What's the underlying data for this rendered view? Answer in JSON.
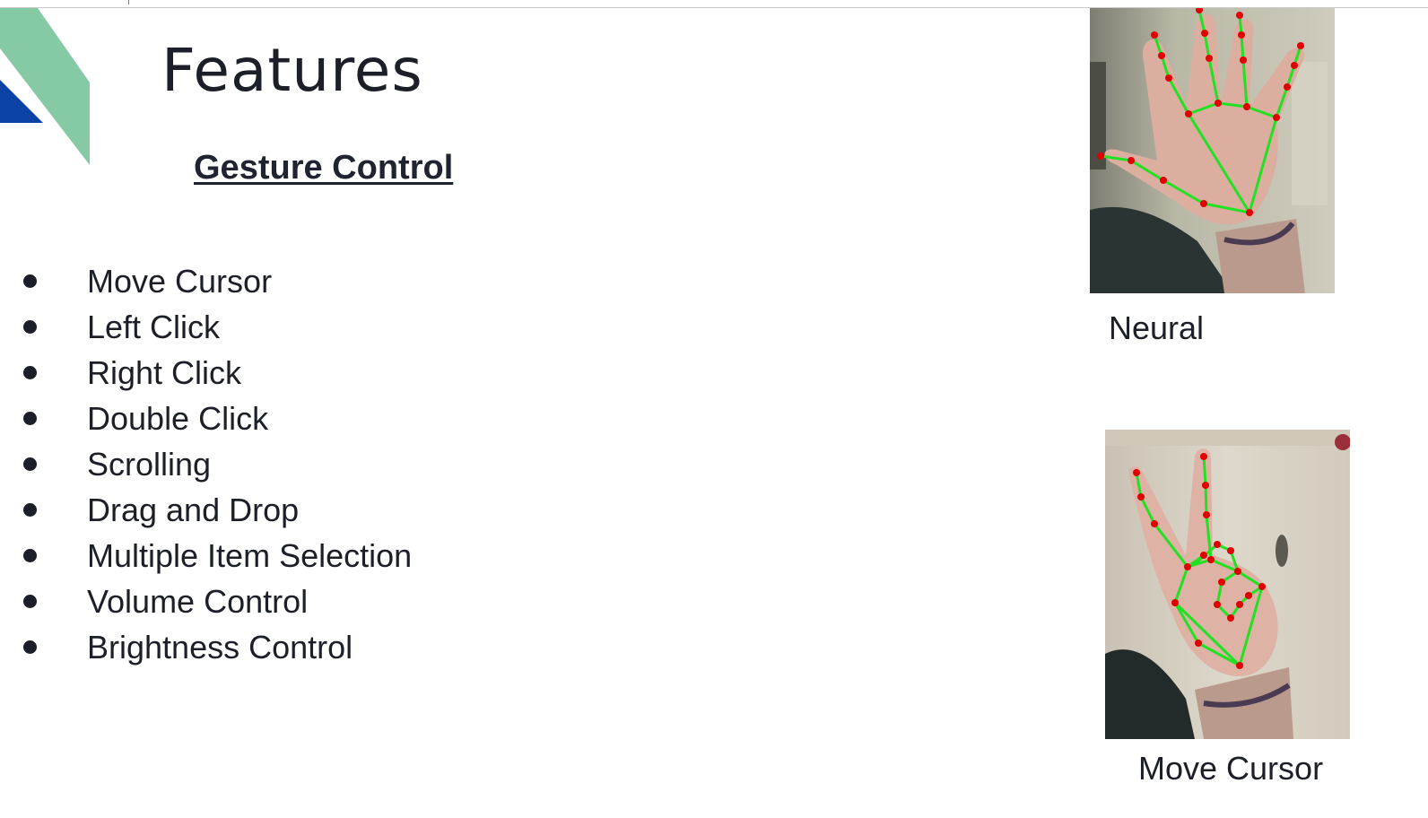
{
  "slide": {
    "title": "Features",
    "subtitle": "Gesture Control"
  },
  "features": [
    "Move Cursor",
    "Left Click",
    "Right Click",
    "Double Click",
    "Scrolling",
    "Drag and Drop",
    "Multiple Item Selection",
    "Volume Control",
    "Brightness Control"
  ],
  "images": [
    {
      "caption": "Neural"
    },
    {
      "caption": "Move Cursor"
    }
  ],
  "colors": {
    "accent_green": "#86c9a5",
    "accent_blue": "#0b44a6",
    "landmark_line": "#22e022",
    "landmark_point": "#e00000"
  }
}
